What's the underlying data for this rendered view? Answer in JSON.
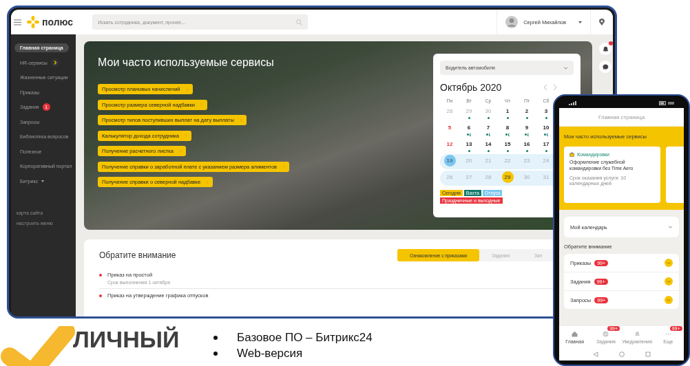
{
  "desktop": {
    "header": {
      "logo_text": "полюс",
      "search": {
        "placeholder": "Искать сотрудника, документ, прочее..."
      },
      "user": {
        "name": "Сергей Михайлов"
      }
    },
    "sidebar": {
      "items": [
        {
          "label": "Главная страница",
          "selected": true,
          "kind": "plain"
        },
        {
          "label": "HR-сервисы",
          "selected": false,
          "kind": "expand"
        },
        {
          "label": "Жизненные ситуации",
          "selected": false,
          "kind": "plain"
        },
        {
          "label": "Приказы",
          "selected": false,
          "kind": "plain"
        },
        {
          "label": "Задания",
          "selected": false,
          "kind": "plain",
          "badge": "1"
        },
        {
          "label": "Запросы",
          "selected": false,
          "kind": "plain"
        },
        {
          "label": "Библиотека вопросов",
          "selected": false,
          "kind": "plain"
        },
        {
          "label": "Полезное",
          "selected": false,
          "kind": "plain"
        },
        {
          "label": "Корпоративный портал",
          "selected": false,
          "kind": "plain"
        },
        {
          "label": "Битрикс",
          "selected": false,
          "kind": "dropdown"
        }
      ],
      "footer_links": [
        "карта сайта",
        "настроить меню"
      ]
    },
    "banner": {
      "title": "Мои часто используемые сервисы",
      "services": [
        "Просмотр плановых начислений",
        "Просмотр размера северной надбавки",
        "Просмотр типов поступивших выплат на дату выплаты",
        "Калькулятор дохода сотрудника",
        "Получение расчетного листка",
        "Получение справки о заработной плате с указанием размера алиментов",
        "Получение справки о северной надбавке"
      ]
    },
    "calendar": {
      "dropdown": "Водитель автомобиля",
      "month": "Октябрь 2020",
      "weekdays": [
        "Пн",
        "Вт",
        "Ср",
        "Чт",
        "Пт",
        "Сб"
      ],
      "weeks": [
        {
          "band": false,
          "days": [
            {
              "day": "28",
              "kind": "muted"
            },
            {
              "day": "29",
              "kind": "muted",
              "shift": true
            },
            {
              "day": "30",
              "kind": "muted",
              "shift": true
            },
            {
              "day": "1",
              "kind": "work",
              "shift": true
            },
            {
              "day": "2",
              "kind": "work",
              "shift": true
            },
            {
              "day": "3",
              "kind": "work",
              "shift": true
            }
          ]
        },
        {
          "band": false,
          "days": [
            {
              "day": "5",
              "kind": "holiday"
            },
            {
              "day": "6",
              "kind": "work",
              "shift": true,
              "night": true
            },
            {
              "day": "7",
              "kind": "work",
              "shift": true,
              "night": true
            },
            {
              "day": "8",
              "kind": "work",
              "shift": true,
              "night": true
            },
            {
              "day": "9",
              "kind": "work",
              "shift": true,
              "night": true
            },
            {
              "day": "10",
              "kind": "work",
              "shift": true,
              "night": true
            }
          ]
        },
        {
          "band": false,
          "days": [
            {
              "day": "12",
              "kind": "holiday"
            },
            {
              "day": "13",
              "kind": "work",
              "shift": true
            },
            {
              "day": "14",
              "kind": "work",
              "shift": true
            },
            {
              "day": "15",
              "kind": "work",
              "shift": true
            },
            {
              "day": "16",
              "kind": "work",
              "shift": true
            },
            {
              "day": "17",
              "kind": "work",
              "shift": true
            }
          ]
        },
        {
          "band": true,
          "days": [
            {
              "day": "19",
              "kind": "muted",
              "vacation": true
            },
            {
              "day": "20",
              "kind": "muted"
            },
            {
              "day": "21",
              "kind": "muted"
            },
            {
              "day": "22",
              "kind": "muted"
            },
            {
              "day": "23",
              "kind": "muted"
            },
            {
              "day": "24",
              "kind": "muted"
            }
          ]
        },
        {
          "band": true,
          "days": [
            {
              "day": "26",
              "kind": "muted"
            },
            {
              "day": "27",
              "kind": "muted"
            },
            {
              "day": "28",
              "kind": "muted"
            },
            {
              "day": "29",
              "kind": "muted",
              "today": true
            },
            {
              "day": "30",
              "kind": "muted"
            },
            {
              "day": "31",
              "kind": "muted"
            }
          ]
        }
      ],
      "legend": [
        {
          "label": "Сегодня",
          "color": "#f5c400"
        },
        {
          "label": "Вахта",
          "color": "#0f7a6a"
        },
        {
          "label": "Отпуск",
          "color": "#7cc7ef"
        },
        {
          "label": "Праздничные и выходные",
          "color": "#e8323c"
        }
      ]
    },
    "rail": {
      "bell_badge": true
    },
    "attention": {
      "title": "Обратите внимание",
      "tabs": [
        {
          "label": "Ознакомление с приказами",
          "selected": true
        },
        {
          "label": "Задания",
          "selected": false
        },
        {
          "label": "Зап",
          "selected": false
        }
      ],
      "items": [
        {
          "title": "Приказ на простой",
          "subtitle": "Срок выполнения 1 октября"
        },
        {
          "title": "Приказ на утверждение графика отпусков"
        }
      ]
    }
  },
  "phone": {
    "header": "Главная страница",
    "services_title": "Мои часто используемые сервисы",
    "service_card": {
      "tag": "Командировки",
      "title": "Оформление служебной командировки без Time Aero",
      "subtitle": "Срок оказания услуги: 10 календарных дней"
    },
    "calendar_label": "Мой календарь",
    "attention_title": "Обратите внимание",
    "list": [
      {
        "label": "Приказы",
        "badge": "99+"
      },
      {
        "label": "Задания",
        "badge": "99+"
      },
      {
        "label": "Запросы",
        "badge": "99+"
      }
    ],
    "nav": [
      {
        "label": "Главная",
        "kind": "home",
        "selected": true
      },
      {
        "label": "Задания",
        "kind": "check",
        "selected": false,
        "badge": "99+"
      },
      {
        "label": "Уведомления",
        "kind": "bell",
        "selected": false
      },
      {
        "label": "Еще",
        "kind": "more",
        "selected": false,
        "badge": "99+"
      }
    ]
  },
  "slide": {
    "logo_text": "ЛИЧНЫЙ",
    "bullets": [
      "Базовое ПО – Битрикс24",
      "Web-версия"
    ]
  }
}
